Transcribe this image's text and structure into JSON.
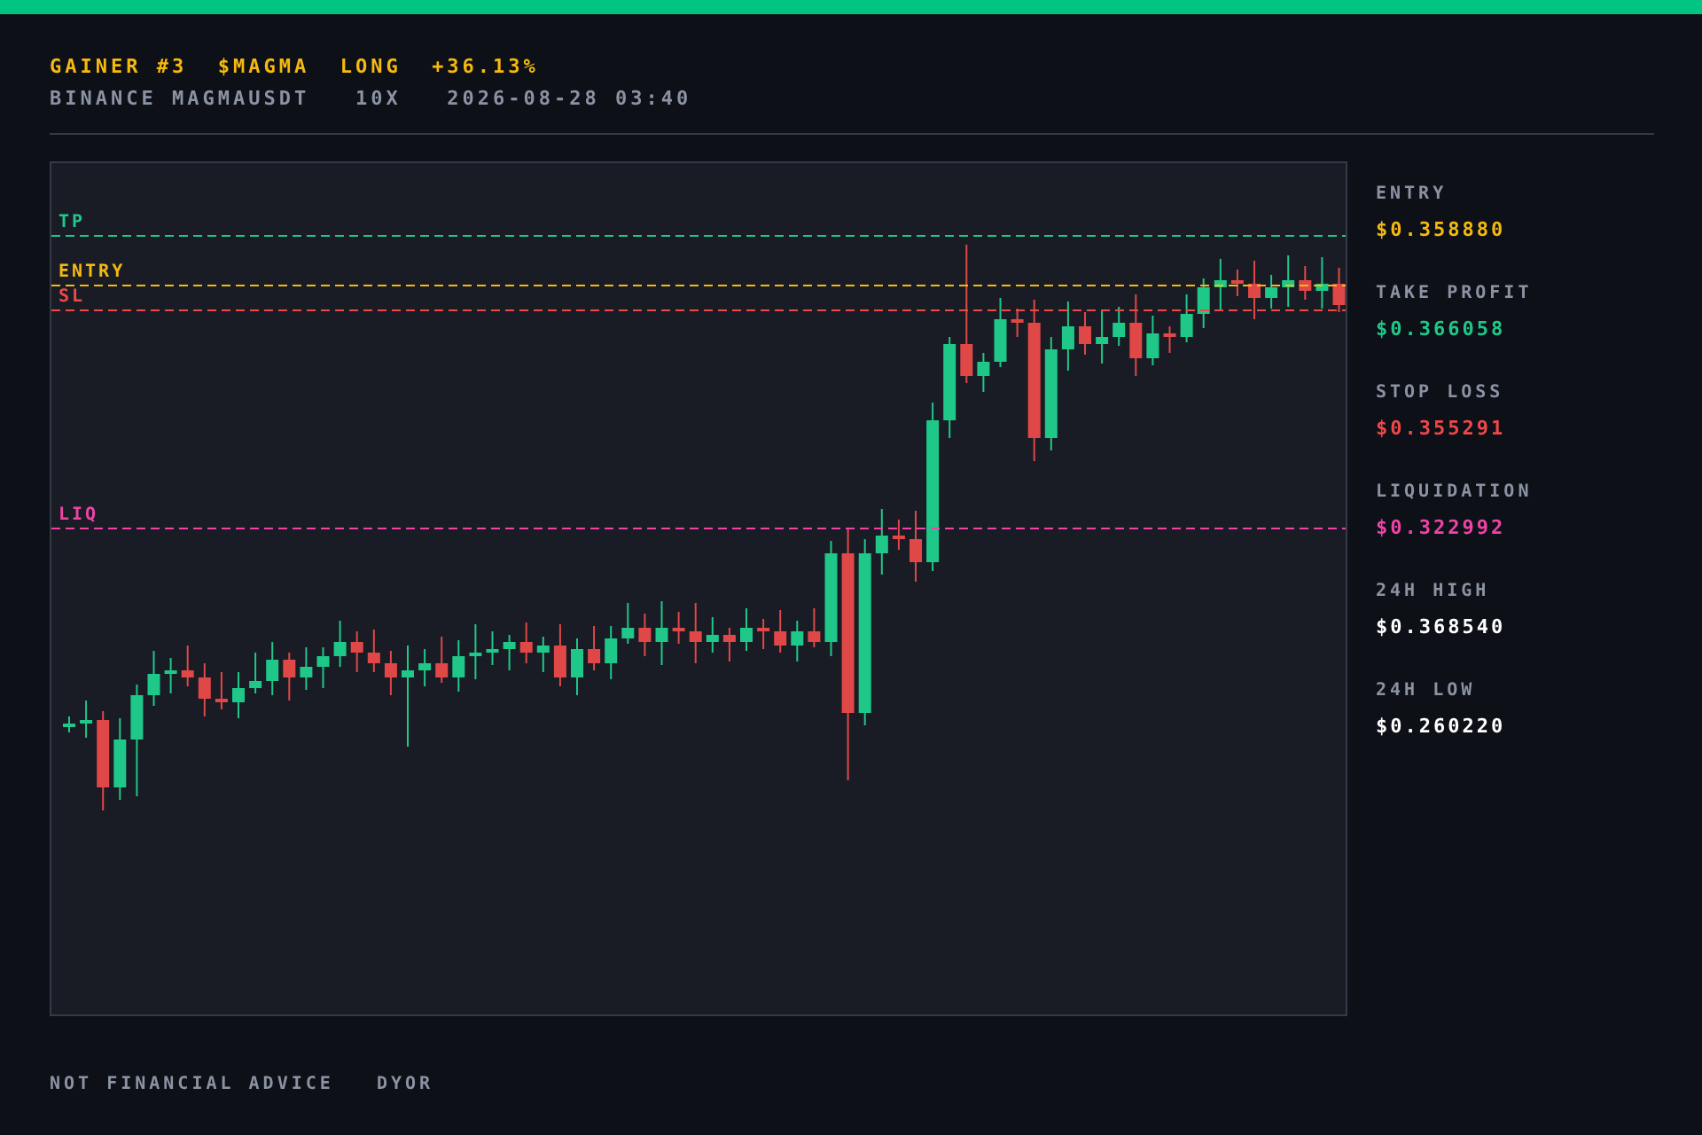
{
  "header": {
    "title": "GAINER #3  $MAGMA  LONG  +36.13%",
    "subtitle": "BINANCE MAGMAUSDT   10X   2026-08-28 03:40"
  },
  "chart": {
    "levels": [
      {
        "label": "TP",
        "color": "#1fc889"
      },
      {
        "label": "ENTRY",
        "color": "#f5b90f"
      },
      {
        "label": "SL",
        "color": "#f04848"
      },
      {
        "label": "LIQ",
        "color": "#f043a6"
      }
    ]
  },
  "stats": [
    {
      "label": "ENTRY",
      "value": "$0.358880",
      "color": "#f5b90f"
    },
    {
      "label": "TAKE PROFIT",
      "value": "$0.366058",
      "color": "#1fc889"
    },
    {
      "label": "STOP LOSS",
      "value": "$0.355291",
      "color": "#f04848"
    },
    {
      "label": "LIQUIDATION",
      "value": "$0.322992",
      "color": "#f043a6"
    },
    {
      "label": "24H HIGH",
      "value": "$0.368540",
      "color": "#ffffff"
    },
    {
      "label": "24H LOW",
      "value": "$0.260220",
      "color": "#ffffff"
    }
  ],
  "footer": "NOT FINANCIAL ADVICE   DYOR"
}
